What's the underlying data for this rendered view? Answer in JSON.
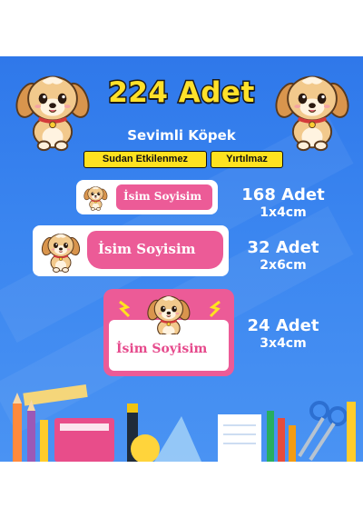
{
  "header": {
    "title": "224 Adet",
    "subtitle": "Sevimli Köpek",
    "badges": [
      "Sudan Etkilenmez",
      "Yırtılmaz"
    ]
  },
  "labels": [
    {
      "name_text": "İsim Soyisim",
      "count": "168 Adet",
      "size": "1x4cm"
    },
    {
      "name_text": "İsim Soyisim",
      "count": "32 Adet",
      "size": "2x6cm"
    },
    {
      "name_text": "İsim Soyisim",
      "count": "24 Adet",
      "size": "3x4cm"
    }
  ],
  "colors": {
    "background_blue": "#3a84ef",
    "title_yellow": "#ffe12a",
    "badge_yellow": "#ffe21f",
    "label_pink": "#ec5b97",
    "name_pink": "#e64a8c"
  },
  "icons": [
    "puppy-illustration",
    "school-stationery-illustration"
  ]
}
